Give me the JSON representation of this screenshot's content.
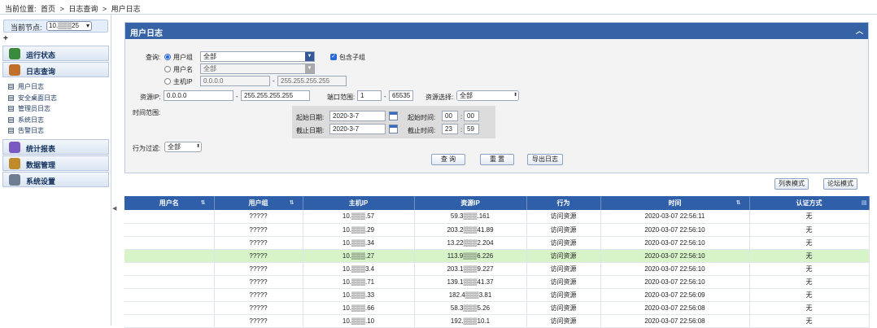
{
  "breadcrumb": {
    "prefix": "当前位置:",
    "items": [
      "首页",
      ">",
      "日志查询",
      ">",
      "用户日志"
    ]
  },
  "sidebar": {
    "node_label": "当前节点:",
    "node_value": "10.▒▒▒25",
    "expand_symbol": "+",
    "menus": [
      {
        "label": "运行状态",
        "icon": "monitor-icon",
        "color": "#3b8a3e"
      },
      {
        "label": "日志查询",
        "icon": "log-icon",
        "color": "#c0702a"
      }
    ],
    "log_items": [
      "用户日志",
      "安全桌面日志",
      "管理员日志",
      "系统日志",
      "告警日志"
    ],
    "menus2": [
      {
        "label": "统计报表",
        "icon": "report-icon",
        "color": "#7a5ac0"
      },
      {
        "label": "数据管理",
        "icon": "database-icon",
        "color": "#c08b2a"
      },
      {
        "label": "系统设置",
        "icon": "settings-icon",
        "color": "#6e7d90"
      }
    ],
    "splitter_symbol": "◀"
  },
  "panel": {
    "title": "用户日志",
    "collapse_symbol": "︿",
    "query_label": "查询:",
    "radio_user_group": "用户组",
    "radio_user_name": "用户名",
    "radio_host_ip": "主机IP",
    "user_group_value": "全部",
    "include_subgroups": "包含子组",
    "user_name_value": "全部",
    "host_ip_from": "0.0.0.0",
    "host_ip_to": "255.255.255.255",
    "resource_ip_label": "资源IP:",
    "resource_ip_from": "0.0.0.0",
    "resource_ip_to": "255.255.255.255",
    "dash": "-",
    "port_range_label": "端口范围:",
    "port_from": "1",
    "port_to": "65535",
    "resource_select_label": "资源选择:",
    "resource_select_value": "全部",
    "time_range_label": "时间范围:",
    "start_date_label": "起始日期:",
    "start_date": "2020-3-7",
    "start_time_label": "起始时间:",
    "start_hour": "00",
    "start_min": "00",
    "end_date_label": "截止日期:",
    "end_date": "2020-3-7",
    "end_time_label": "截止时间:",
    "end_hour": "23",
    "end_min": "59",
    "colon": ":",
    "action_filter_label": "行为过滤:",
    "action_filter_value": "全部",
    "query_button": "查 询",
    "reset_button": "重 置",
    "export_button": "导出日志"
  },
  "view_buttons": {
    "list": "列表模式",
    "forum": "论坛模式"
  },
  "table": {
    "columns": [
      "用户名",
      "用户组",
      "主机IP",
      "资源IP",
      "行为",
      "时间",
      "认证方式"
    ],
    "rows": [
      {
        "user": "",
        "group": "?????",
        "host": "10.▒▒▒.57",
        "res": "59.3▒▒▒.161",
        "act": "访问资源",
        "time": "2020-03-07 22:56:11",
        "auth": "无"
      },
      {
        "user": "",
        "group": "?????",
        "host": "10.▒▒▒.29",
        "res": "203.2▒▒▒41.89",
        "act": "访问资源",
        "time": "2020-03-07 22:56:10",
        "auth": "无"
      },
      {
        "user": "",
        "group": "?????",
        "host": "10.▒▒▒.34",
        "res": "13.22▒▒▒2.204",
        "act": "访问资源",
        "time": "2020-03-07 22:56:10",
        "auth": "无"
      },
      {
        "user": "",
        "group": "?????",
        "host": "10.▒▒▒.27",
        "res": "113.9▒▒▒6.226",
        "act": "访问资源",
        "time": "2020-03-07 22:56:10",
        "auth": "无"
      },
      {
        "user": "",
        "group": "?????",
        "host": "10.▒▒▒3.4",
        "res": "203.1▒▒▒9.227",
        "act": "访问资源",
        "time": "2020-03-07 22:56:10",
        "auth": "无"
      },
      {
        "user": "",
        "group": "?????",
        "host": "10.▒▒▒.71",
        "res": "139.1▒▒▒41.37",
        "act": "访问资源",
        "time": "2020-03-07 22:56:10",
        "auth": "无"
      },
      {
        "user": "",
        "group": "?????",
        "host": "10.▒▒▒.33",
        "res": "182.4▒▒▒3.81",
        "act": "访问资源",
        "time": "2020-03-07 22:56:09",
        "auth": "无"
      },
      {
        "user": "",
        "group": "?????",
        "host": "10.▒▒▒.66",
        "res": "58.3▒▒▒5.26",
        "act": "访问资源",
        "time": "2020-03-07 22:56:08",
        "auth": "无"
      },
      {
        "user": "",
        "group": "?????",
        "host": "10.▒▒▒.10",
        "res": "192.▒▒▒10.1",
        "act": "访问资源",
        "time": "2020-03-07 22:56:08",
        "auth": "无"
      }
    ],
    "selected_row": 3
  }
}
